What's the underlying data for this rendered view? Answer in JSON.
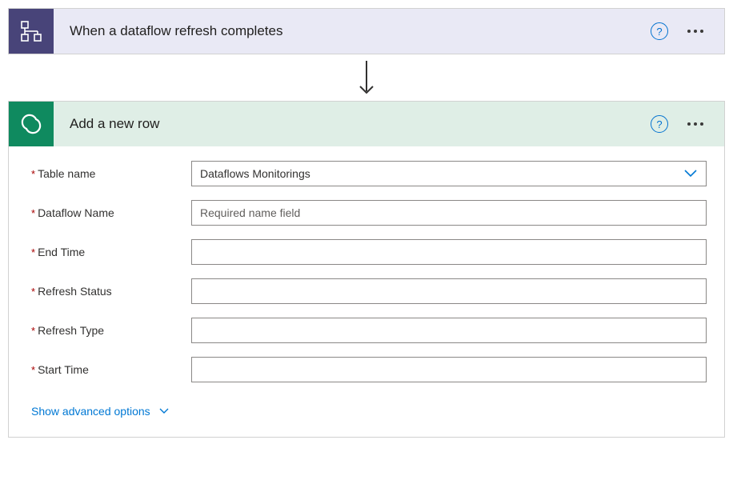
{
  "trigger": {
    "title": "When a dataflow refresh completes"
  },
  "action": {
    "title": "Add a new row",
    "fields": {
      "table_name": {
        "label": "Table name",
        "value": "Dataflows Monitorings"
      },
      "dataflow_name": {
        "label": "Dataflow Name",
        "placeholder": "Required name field",
        "value": ""
      },
      "end_time": {
        "label": "End Time",
        "value": ""
      },
      "refresh_status": {
        "label": "Refresh Status",
        "value": ""
      },
      "refresh_type": {
        "label": "Refresh Type",
        "value": ""
      },
      "start_time": {
        "label": "Start Time",
        "value": ""
      }
    },
    "advanced_label": "Show advanced options"
  }
}
